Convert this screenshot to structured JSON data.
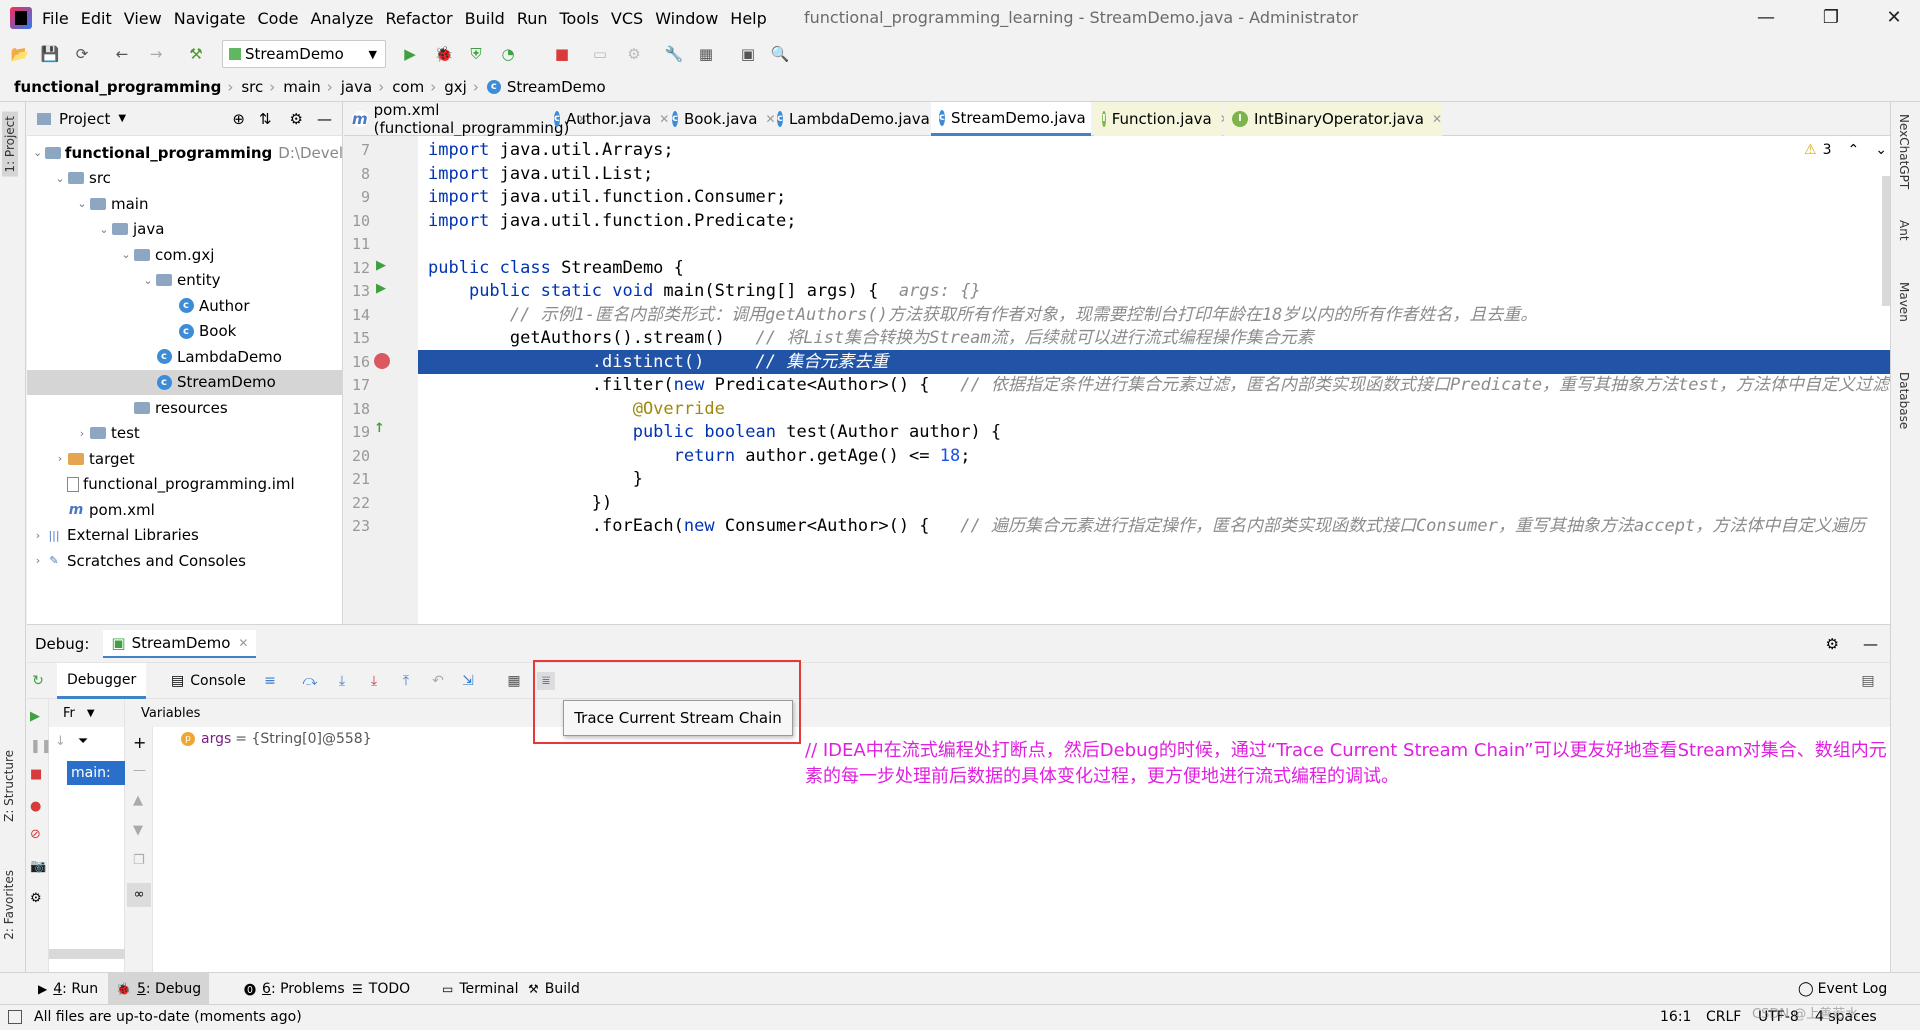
{
  "menubar": {
    "items": [
      "File",
      "Edit",
      "View",
      "Navigate",
      "Code",
      "Analyze",
      "Refactor",
      "Build",
      "Run",
      "Tools",
      "VCS",
      "Window",
      "Help"
    ],
    "title": "functional_programming_learning - StreamDemo.java - Administrator"
  },
  "toolbar": {
    "run_config": "StreamDemo"
  },
  "breadcrumb": [
    "functional_programming",
    "src",
    "main",
    "java",
    "com",
    "gxj",
    "StreamDemo"
  ],
  "left_stripe": {
    "project_tab": "1: Project",
    "structure_tab": "Z: Structure",
    "favorites_tab": "2: Favorites"
  },
  "project": {
    "header": "Project",
    "tree": [
      {
        "label": "functional_programming",
        "suffix": "D:\\Devel",
        "depth": 0,
        "icon": "folder",
        "open": true
      },
      {
        "label": "src",
        "depth": 1,
        "icon": "folder",
        "open": true
      },
      {
        "label": "main",
        "depth": 2,
        "icon": "folder",
        "open": true
      },
      {
        "label": "java",
        "depth": 3,
        "icon": "folder",
        "open": true
      },
      {
        "label": "com.gxj",
        "depth": 4,
        "icon": "folder",
        "open": true
      },
      {
        "label": "entity",
        "depth": 5,
        "icon": "folder",
        "open": true
      },
      {
        "label": "Author",
        "depth": 6,
        "icon": "class"
      },
      {
        "label": "Book",
        "depth": 6,
        "icon": "class"
      },
      {
        "label": "LambdaDemo",
        "depth": 5,
        "icon": "class"
      },
      {
        "label": "StreamDemo",
        "depth": 5,
        "icon": "class",
        "selected": true
      },
      {
        "label": "resources",
        "depth": 4,
        "icon": "folder"
      },
      {
        "label": "test",
        "depth": 2,
        "icon": "folder",
        "closed": true
      },
      {
        "label": "target",
        "depth": 1,
        "icon": "folder-orange",
        "closed": true
      },
      {
        "label": "functional_programming.iml",
        "depth": 1,
        "icon": "file"
      },
      {
        "label": "pom.xml",
        "depth": 1,
        "icon": "maven"
      },
      {
        "label": "External Libraries",
        "depth": 0,
        "icon": "lib",
        "closed": true
      },
      {
        "label": "Scratches and Consoles",
        "depth": 0,
        "icon": "scratch",
        "closed": true
      }
    ]
  },
  "editor_tabs": [
    {
      "label": "pom.xml (functional_programming)",
      "icon": "m"
    },
    {
      "label": "Author.java",
      "icon": "c"
    },
    {
      "label": "Book.java",
      "icon": "c"
    },
    {
      "label": "LambdaDemo.java",
      "icon": "c"
    },
    {
      "label": "StreamDemo.java",
      "icon": "c",
      "active": true
    },
    {
      "label": "Function.java",
      "icon": "i"
    },
    {
      "label": "IntBinaryOperator.java",
      "icon": "i"
    }
  ],
  "editor": {
    "warnings": "3",
    "lines": [
      {
        "n": "7",
        "tokens": [
          [
            "kw",
            "import"
          ],
          [
            "t",
            " java.util.Arrays;"
          ]
        ]
      },
      {
        "n": "8",
        "tokens": [
          [
            "kw",
            "import"
          ],
          [
            "t",
            " java.util.List;"
          ]
        ]
      },
      {
        "n": "9",
        "tokens": [
          [
            "kw",
            "import"
          ],
          [
            "t",
            " java.util.function.Consumer;"
          ]
        ]
      },
      {
        "n": "10",
        "tokens": [
          [
            "kw",
            "import"
          ],
          [
            "t",
            " java.util.function.Predicate;"
          ]
        ]
      },
      {
        "n": "11",
        "tokens": []
      },
      {
        "n": "12",
        "tokens": [
          [
            "kw",
            "public class"
          ],
          [
            "t",
            " StreamDemo {"
          ]
        ]
      },
      {
        "n": "13",
        "tokens": [
          [
            "t",
            "    "
          ],
          [
            "kw",
            "public static void"
          ],
          [
            "t",
            " main(String[] args) {  "
          ],
          [
            "hint",
            "args: {}"
          ]
        ]
      },
      {
        "n": "14",
        "tokens": [
          [
            "t",
            "        "
          ],
          [
            "cm",
            "// 示例1-匿名内部类形式：调用getAuthors()方法获取所有作者对象，现需要控制台打印年龄在18岁以内的所有作者姓名，且去重。"
          ]
        ]
      },
      {
        "n": "15",
        "tokens": [
          [
            "t",
            "        getAuthors().stream()   "
          ],
          [
            "cm",
            "// 将List集合转换为Stream流，后续就可以进行流式编程操作集合元素"
          ]
        ]
      },
      {
        "n": "16",
        "tokens": [
          [
            "t",
            "                .distinct()     "
          ],
          [
            "cm",
            "// 集合元素去重"
          ]
        ],
        "highlight": true
      },
      {
        "n": "17",
        "tokens": [
          [
            "t",
            "                .filter("
          ],
          [
            "kw",
            "new"
          ],
          [
            "t",
            " Predicate<Author>() {   "
          ],
          [
            "cm",
            "// 依据指定条件进行集合元素过滤，匿名内部类实现函数式接口Predicate，重写其抽象方法test，方法体中自定义过滤"
          ]
        ]
      },
      {
        "n": "18",
        "tokens": [
          [
            "t",
            "                    "
          ],
          [
            "ann",
            "@Override"
          ]
        ]
      },
      {
        "n": "19",
        "tokens": [
          [
            "t",
            "                    "
          ],
          [
            "kw",
            "public boolean"
          ],
          [
            "t",
            " test(Author author) {"
          ]
        ]
      },
      {
        "n": "20",
        "tokens": [
          [
            "t",
            "                        "
          ],
          [
            "kw",
            "return"
          ],
          [
            "t",
            " author.getAge() <= "
          ],
          [
            "num",
            "18"
          ],
          [
            "t",
            ";"
          ]
        ]
      },
      {
        "n": "21",
        "tokens": [
          [
            "t",
            "                    }"
          ]
        ]
      },
      {
        "n": "22",
        "tokens": [
          [
            "t",
            "                })"
          ]
        ]
      },
      {
        "n": "23",
        "tokens": [
          [
            "t",
            "                .forEach("
          ],
          [
            "kw",
            "new"
          ],
          [
            "t",
            " Consumer<Author>() {   "
          ],
          [
            "cm",
            "// 遍历集合元素进行指定操作，匿名内部类实现函数式接口Consumer，重写其抽象方法accept，方法体中自定义遍历"
          ]
        ]
      }
    ]
  },
  "debug": {
    "label": "Debug:",
    "session": "StreamDemo",
    "tabs": [
      "Debugger",
      "Console"
    ],
    "frames_label": "Fr",
    "variables_label": "Variables",
    "thread": "main:",
    "variable": {
      "name": "args",
      "value": "= {String[0]@558}"
    },
    "tooltip": "Trace Current Stream Chain"
  },
  "annotation": "// IDEA中在流式编程处打断点，然后Debug的时候，通过“Trace Current Stream Chain”可以更友好地查看Stream对集合、数组内元素的每一步处理前后数据的具体变化过程，更方便地进行流式编程的调试。",
  "toolwindows": [
    {
      "num": "4",
      "label": ": Run"
    },
    {
      "num": "5",
      "label": ": Debug",
      "active": true
    },
    {
      "num": "6",
      "label": ": Problems"
    },
    {
      "num": "",
      "label": "TODO"
    },
    {
      "num": "",
      "label": "Terminal"
    },
    {
      "num": "",
      "label": "Build"
    }
  ],
  "event_log": "Event Log",
  "right_stripe": [
    "NexChatGPT",
    "Ant",
    "Maven",
    "Database"
  ],
  "status": {
    "message": "All files are up-to-date (moments ago)",
    "position": "16:1",
    "line_sep": "CRLF",
    "encoding": "UTF-8",
    "indent": "4 spaces",
    "watermark": "CSDN @上善若水"
  }
}
